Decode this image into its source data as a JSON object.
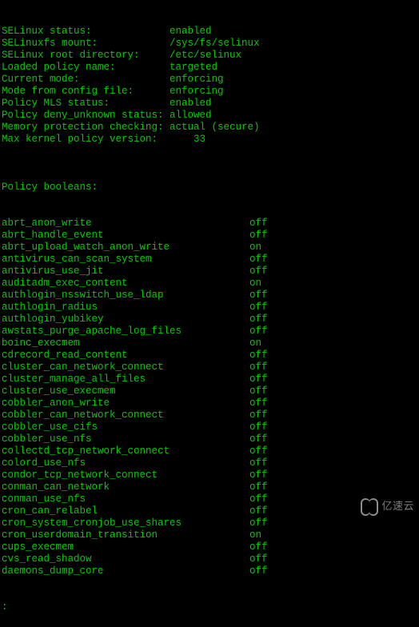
{
  "status_lines": [
    {
      "label": "SELinux status:",
      "pad": 28,
      "value": "enabled"
    },
    {
      "label": "SELinuxfs mount:",
      "pad": 28,
      "value": "/sys/fs/selinux"
    },
    {
      "label": "SELinux root directory:",
      "pad": 28,
      "value": "/etc/selinux"
    },
    {
      "label": "Loaded policy name:",
      "pad": 28,
      "value": "targeted"
    },
    {
      "label": "Current mode:",
      "pad": 28,
      "value": "enforcing"
    },
    {
      "label": "Mode from config file:",
      "pad": 28,
      "value": "enforcing"
    },
    {
      "label": "Policy MLS status:",
      "pad": 28,
      "value": "enabled"
    },
    {
      "label": "Policy deny_unknown status:",
      "pad": 28,
      "value": "allowed"
    },
    {
      "label": "Memory protection checking:",
      "pad": 28,
      "value": "actual (secure)"
    },
    {
      "label": "Max kernel policy version:",
      "pad": 32,
      "value": "33"
    }
  ],
  "booleans_header": "Policy booleans:",
  "booleans": [
    {
      "name": "abrt_anon_write",
      "value": "off"
    },
    {
      "name": "abrt_handle_event",
      "value": "off"
    },
    {
      "name": "abrt_upload_watch_anon_write",
      "value": "on"
    },
    {
      "name": "antivirus_can_scan_system",
      "value": "off"
    },
    {
      "name": "antivirus_use_jit",
      "value": "off"
    },
    {
      "name": "auditadm_exec_content",
      "value": "on"
    },
    {
      "name": "authlogin_nsswitch_use_ldap",
      "value": "off"
    },
    {
      "name": "authlogin_radius",
      "value": "off"
    },
    {
      "name": "authlogin_yubikey",
      "value": "off"
    },
    {
      "name": "awstats_purge_apache_log_files",
      "value": "off"
    },
    {
      "name": "boinc_execmem",
      "value": "on"
    },
    {
      "name": "cdrecord_read_content",
      "value": "off"
    },
    {
      "name": "cluster_can_network_connect",
      "value": "off"
    },
    {
      "name": "cluster_manage_all_files",
      "value": "off"
    },
    {
      "name": "cluster_use_execmem",
      "value": "off"
    },
    {
      "name": "cobbler_anon_write",
      "value": "off"
    },
    {
      "name": "cobbler_can_network_connect",
      "value": "off"
    },
    {
      "name": "cobbler_use_cifs",
      "value": "off"
    },
    {
      "name": "cobbler_use_nfs",
      "value": "off"
    },
    {
      "name": "collectd_tcp_network_connect",
      "value": "off"
    },
    {
      "name": "colord_use_nfs",
      "value": "off"
    },
    {
      "name": "condor_tcp_network_connect",
      "value": "off"
    },
    {
      "name": "conman_can_network",
      "value": "off"
    },
    {
      "name": "conman_use_nfs",
      "value": "off"
    },
    {
      "name": "cron_can_relabel",
      "value": "off"
    },
    {
      "name": "cron_system_cronjob_use_shares",
      "value": "off"
    },
    {
      "name": "cron_userdomain_transition",
      "value": "on"
    },
    {
      "name": "cups_execmem",
      "value": "off"
    },
    {
      "name": "cvs_read_shadow",
      "value": "off"
    },
    {
      "name": "daemons_dump_core",
      "value": "off"
    }
  ],
  "prompt": ":",
  "watermark_text": "亿速云"
}
